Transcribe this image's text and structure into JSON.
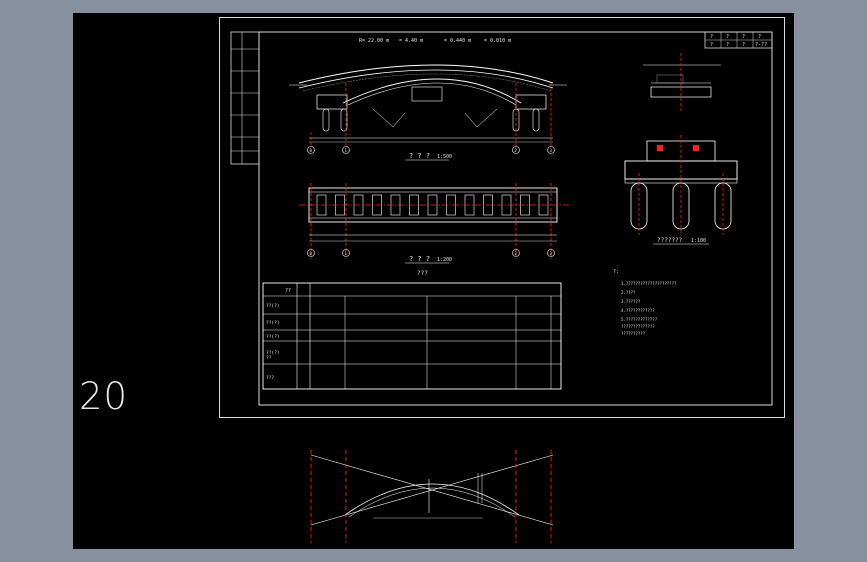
{
  "sheet_number": "20",
  "colors": {
    "background": "#86909f",
    "canvas": "#000000",
    "line": "#ffffff",
    "centerline": "#ff2020",
    "label": "#e6e6e6"
  },
  "elevation": {
    "params": [
      "R= 22.00 m",
      "= 4.40 m",
      "= 0.440 m",
      "= 0.010 m"
    ],
    "title": "? ? ?",
    "scale": "1:500",
    "axes": [
      "0",
      "1",
      "2",
      "3"
    ]
  },
  "plan": {
    "title": "? ? ?",
    "scale": "1:200",
    "axes": [
      "0",
      "1",
      "2",
      "3"
    ]
  },
  "section": {
    "title": "???????",
    "scale": "1:100"
  },
  "table": {
    "title": "???",
    "col_header": "??",
    "rows": [
      "??(?)",
      "??(?)",
      "??(?)",
      "??(?)",
      "??",
      "???"
    ]
  },
  "notes": {
    "heading": "?:",
    "lines": [
      "1.?????????????????????",
      "2.????",
      "3.??????",
      "4.????????????",
      "5.?????????????",
      "  ??????????????",
      "  ??????????"
    ]
  },
  "title_block": {
    "cells": [
      "?",
      "?",
      "?",
      "?",
      "?",
      "?",
      "?",
      "?-??"
    ]
  }
}
